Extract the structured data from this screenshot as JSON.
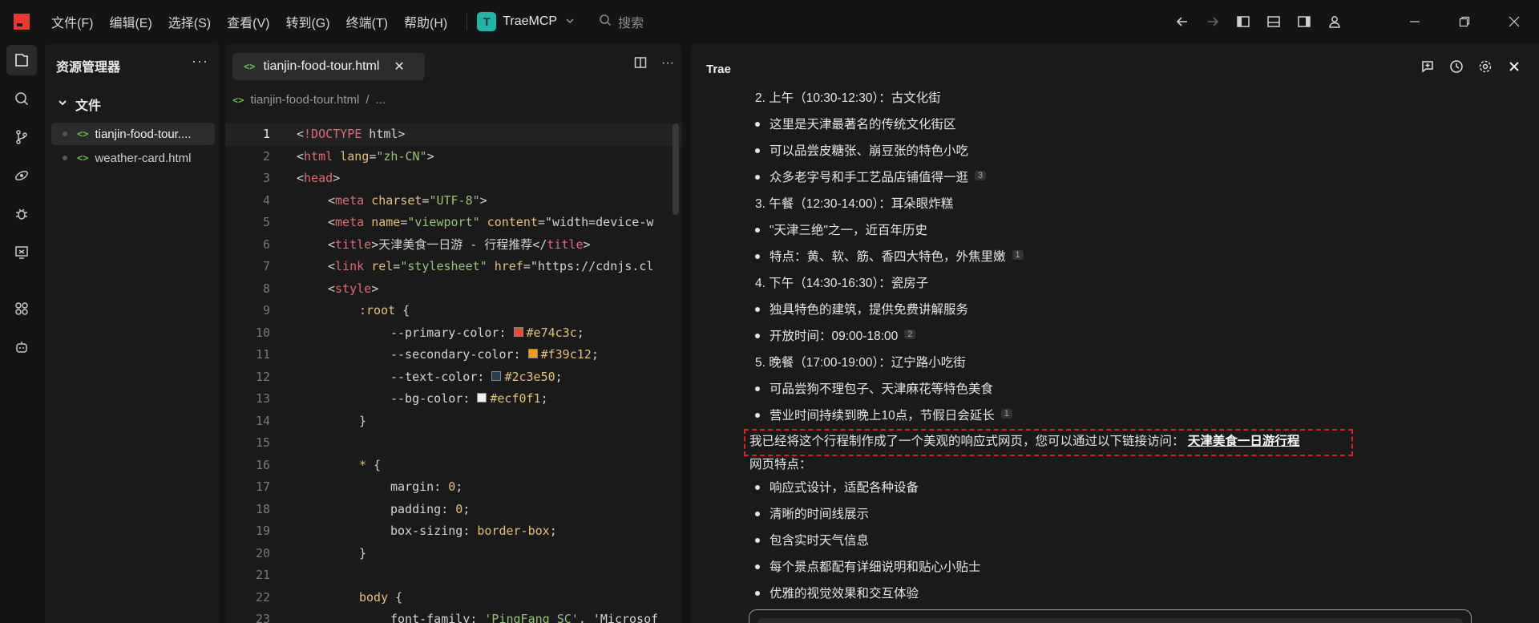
{
  "titlebar": {
    "menu": [
      "文件(F)",
      "编辑(E)",
      "选择(S)",
      "查看(V)",
      "转到(G)",
      "终端(T)",
      "帮助(H)"
    ],
    "project_badge": "T",
    "project_name": "TraeMCP",
    "search_placeholder": "搜索"
  },
  "explorer": {
    "title": "资源管理器",
    "folder": "文件",
    "files": [
      {
        "ext": "<>",
        "name": "tianjin-food-tour...."
      },
      {
        "ext": "<>",
        "name": "weather-card.html"
      }
    ]
  },
  "editor": {
    "tab_label": "tianjin-food-tour.html",
    "tab_icon": "<>",
    "breadcrumb_file": "tianjin-food-tour.html",
    "breadcrumb_more": "...",
    "swatches": [
      "#e74c3c",
      "#f39c12",
      "#2c3e50",
      "#ecf0f1"
    ],
    "lines": [
      "<!DOCTYPE html>",
      "<html lang=\"zh-CN\">",
      "<head>",
      "<meta charset=\"UTF-8\">",
      "<meta name=\"viewport\" content=\"width=device-w",
      "<title>天津美食一日游 - 行程推荐</title>",
      "<link rel=\"stylesheet\" href=\"https://cdnjs.cl",
      "<style>",
      ":root {",
      "--primary-color: #e74c3c;",
      "--secondary-color: #f39c12;",
      "--text-color: #2c3e50;",
      "--bg-color: #ecf0f1;",
      "}",
      "",
      "* {",
      "margin: 0;",
      "padding: 0;",
      "box-sizing: border-box;",
      "}",
      "",
      "body {",
      "font-family: 'PingFang SC', 'Microsof"
    ]
  },
  "chat": {
    "title": "Trae",
    "messages": [
      {
        "kind": "num",
        "text": "2. 上午（10:30-12:30）：古文化街"
      },
      {
        "kind": "bullet",
        "text": "这里是天津最著名的传统文化街区"
      },
      {
        "kind": "bullet",
        "text": "可以品尝皮糖张、崩豆张的特色小吃"
      },
      {
        "kind": "bullet",
        "text": "众多老字号和手工艺品店铺值得一逛",
        "cite": "3"
      },
      {
        "kind": "num",
        "text": "3. 午餐（12:30-14:00）：耳朵眼炸糕"
      },
      {
        "kind": "bullet",
        "text": "\"天津三绝\"之一，近百年历史"
      },
      {
        "kind": "bullet",
        "text": "特点：黄、软、筋、香四大特色，外焦里嫩",
        "cite": "1"
      },
      {
        "kind": "num",
        "text": "4. 下午（14:30-16:30）：瓷房子"
      },
      {
        "kind": "bullet",
        "text": "独具特色的建筑，提供免费讲解服务"
      },
      {
        "kind": "bullet",
        "text": "开放时间：09:00-18:00",
        "cite": "2"
      },
      {
        "kind": "num",
        "text": "5. 晚餐（17:00-19:00）：辽宁路小吃街"
      },
      {
        "kind": "bullet",
        "text": "可品尝狗不理包子、天津麻花等特色美食"
      },
      {
        "kind": "bullet",
        "text": "营业时间持续到晚上10点，节假日会延长",
        "cite": "1"
      }
    ],
    "summary_text": "我已经将这个行程制作成了一个美观的响应式网页，您可以通过以下链接访问：",
    "summary_link": "天津美食一日游行程",
    "features_title": "网页特点：",
    "features": [
      "响应式设计，适配各种设备",
      "清晰的时间线展示",
      "包含实时天气信息",
      "每个景点都配有详细说明和贴心小贴士",
      "优雅的视觉效果和交互体验"
    ]
  }
}
